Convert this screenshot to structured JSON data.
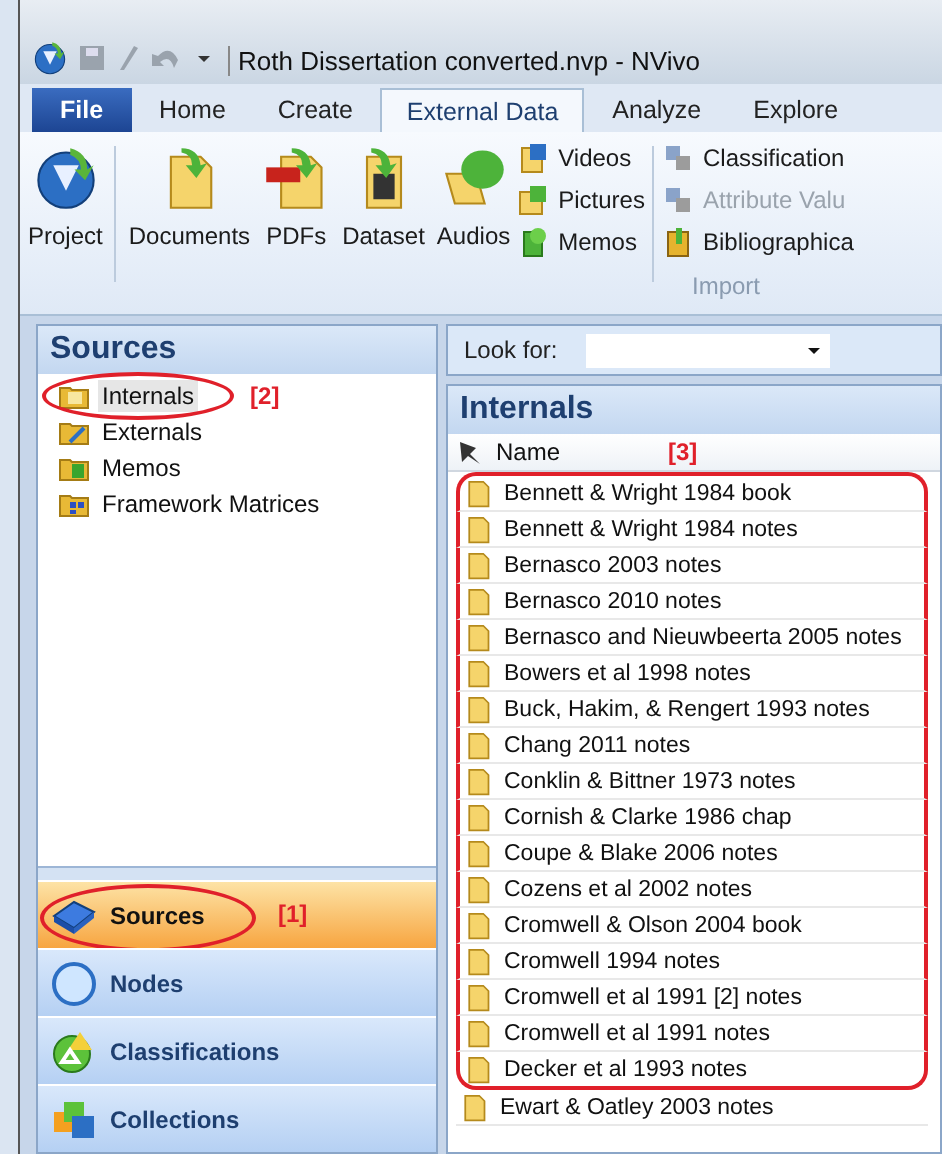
{
  "window": {
    "title": "Roth Dissertation converted.nvp - NVivo"
  },
  "tabs": [
    {
      "label": "File",
      "kind": "file",
      "selected": false
    },
    {
      "label": "Home",
      "kind": "tab",
      "selected": false
    },
    {
      "label": "Create",
      "kind": "tab",
      "selected": false
    },
    {
      "label": "External Data",
      "kind": "tab",
      "selected": true
    },
    {
      "label": "Analyze",
      "kind": "tab",
      "selected": false
    },
    {
      "label": "Explore",
      "kind": "tab",
      "selected": false
    }
  ],
  "ribbon": {
    "large_buttons": [
      {
        "label": "Project",
        "kind": "globe"
      },
      {
        "label": "Documents",
        "kind": "doc"
      },
      {
        "label": "PDFs",
        "kind": "pdf"
      },
      {
        "label": "Dataset",
        "kind": "sheet"
      },
      {
        "label": "Audios",
        "kind": "audio"
      }
    ],
    "small_buttons": [
      {
        "label": "Videos",
        "kind": "video",
        "disabled": false
      },
      {
        "label": "Pictures",
        "kind": "picture",
        "disabled": false
      },
      {
        "label": "Memos",
        "kind": "memo",
        "disabled": false
      }
    ],
    "small_buttons_2": [
      {
        "label": "Classification",
        "kind": "class",
        "disabled": false
      },
      {
        "label": "Attribute Valu",
        "kind": "class",
        "disabled": true
      },
      {
        "label": "Bibliographica",
        "kind": "biblio",
        "disabled": false
      }
    ],
    "group_label": "Import"
  },
  "sources_panel": {
    "title": "Sources",
    "items": [
      {
        "label": "Internals",
        "kind": "internals",
        "selected": true,
        "callout": "[2]"
      },
      {
        "label": "Externals",
        "kind": "externals",
        "selected": false
      },
      {
        "label": "Memos",
        "kind": "memos",
        "selected": false
      },
      {
        "label": "Framework Matrices",
        "kind": "matrices",
        "selected": false
      }
    ]
  },
  "navigation": [
    {
      "label": "Sources",
      "kind": "sources",
      "selected": true,
      "callout": "[1]"
    },
    {
      "label": "Nodes",
      "kind": "nodes",
      "selected": false
    },
    {
      "label": "Classifications",
      "kind": "classifications",
      "selected": false
    },
    {
      "label": "Collections",
      "kind": "collections",
      "selected": false
    }
  ],
  "search": {
    "label": "Look for:"
  },
  "list": {
    "title": "Internals",
    "columns": [
      "Name"
    ],
    "callout": "[3]",
    "rows": [
      {
        "name": "Bennett & Wright 1984 book",
        "circled": true
      },
      {
        "name": "Bennett & Wright 1984 notes",
        "circled": true
      },
      {
        "name": "Bernasco 2003 notes",
        "circled": true
      },
      {
        "name": "Bernasco 2010 notes",
        "circled": true
      },
      {
        "name": "Bernasco and Nieuwbeerta 2005 notes",
        "circled": true
      },
      {
        "name": "Bowers et al 1998 notes",
        "circled": true
      },
      {
        "name": "Buck, Hakim, & Rengert 1993 notes",
        "circled": true
      },
      {
        "name": "Chang 2011 notes",
        "circled": true
      },
      {
        "name": "Conklin & Bittner 1973 notes",
        "circled": true
      },
      {
        "name": "Cornish & Clarke 1986 chap",
        "circled": true
      },
      {
        "name": "Coupe & Blake 2006 notes",
        "circled": true
      },
      {
        "name": "Cozens et al 2002 notes",
        "circled": true
      },
      {
        "name": "Cromwell & Olson 2004 book",
        "circled": true
      },
      {
        "name": "Cromwell 1994 notes",
        "circled": true
      },
      {
        "name": "Cromwell et al 1991 [2] notes",
        "circled": true
      },
      {
        "name": "Cromwell et al 1991 notes",
        "circled": true
      },
      {
        "name": "Decker et al 1993 notes",
        "circled": true
      },
      {
        "name": "Ewart & Oatley 2003 notes",
        "circled": false
      }
    ]
  }
}
